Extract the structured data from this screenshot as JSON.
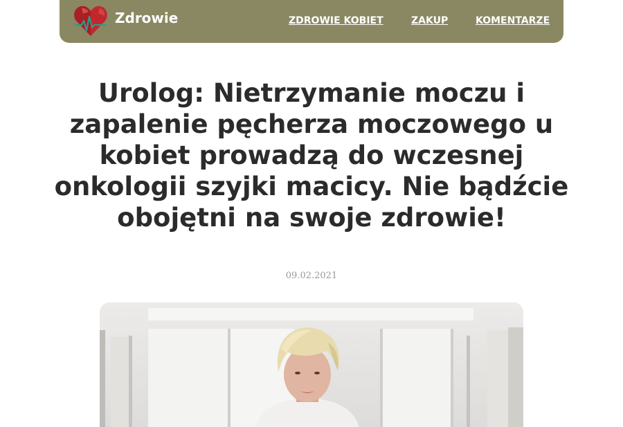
{
  "header": {
    "brand": "Zdrowie",
    "logo_icon": "heart-pulse-icon",
    "nav": [
      {
        "label": "ZDROWIE KOBIET"
      },
      {
        "label": "ZAKUP"
      },
      {
        "label": "KOMENTARZE"
      }
    ]
  },
  "article": {
    "title": "Urolog: Nietrzymanie moczu i zapalenie pęcherza moczowego u kobiet prowadzą do wczesnej onkologii szyjki macicy. Nie bądźcie obojętni na swoje zdrowie!",
    "date": "09.02.2021",
    "image_icon": "doctor-photo"
  },
  "colors": {
    "header_bg": "#8a8862",
    "title_text": "#2b2b2b",
    "date_text": "#9a9a9a",
    "heart": "#c0282d",
    "pulse": "#2e9b8a"
  }
}
